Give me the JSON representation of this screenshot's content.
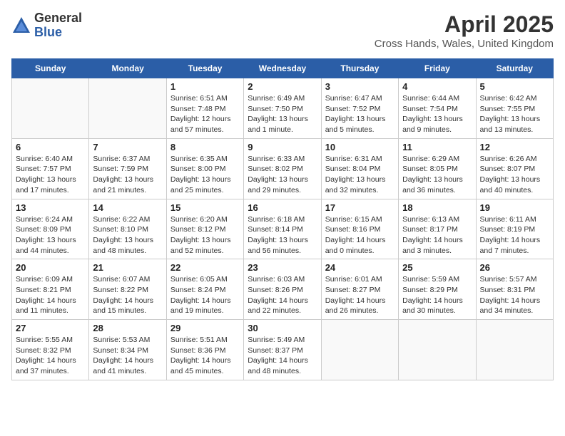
{
  "header": {
    "logo_line1": "General",
    "logo_line2": "Blue",
    "main_title": "April 2025",
    "subtitle": "Cross Hands, Wales, United Kingdom"
  },
  "days_of_week": [
    "Sunday",
    "Monday",
    "Tuesday",
    "Wednesday",
    "Thursday",
    "Friday",
    "Saturday"
  ],
  "weeks": [
    [
      {
        "day": "",
        "info": ""
      },
      {
        "day": "",
        "info": ""
      },
      {
        "day": "1",
        "info": "Sunrise: 6:51 AM\nSunset: 7:48 PM\nDaylight: 12 hours and 57 minutes."
      },
      {
        "day": "2",
        "info": "Sunrise: 6:49 AM\nSunset: 7:50 PM\nDaylight: 13 hours and 1 minute."
      },
      {
        "day": "3",
        "info": "Sunrise: 6:47 AM\nSunset: 7:52 PM\nDaylight: 13 hours and 5 minutes."
      },
      {
        "day": "4",
        "info": "Sunrise: 6:44 AM\nSunset: 7:54 PM\nDaylight: 13 hours and 9 minutes."
      },
      {
        "day": "5",
        "info": "Sunrise: 6:42 AM\nSunset: 7:55 PM\nDaylight: 13 hours and 13 minutes."
      }
    ],
    [
      {
        "day": "6",
        "info": "Sunrise: 6:40 AM\nSunset: 7:57 PM\nDaylight: 13 hours and 17 minutes."
      },
      {
        "day": "7",
        "info": "Sunrise: 6:37 AM\nSunset: 7:59 PM\nDaylight: 13 hours and 21 minutes."
      },
      {
        "day": "8",
        "info": "Sunrise: 6:35 AM\nSunset: 8:00 PM\nDaylight: 13 hours and 25 minutes."
      },
      {
        "day": "9",
        "info": "Sunrise: 6:33 AM\nSunset: 8:02 PM\nDaylight: 13 hours and 29 minutes."
      },
      {
        "day": "10",
        "info": "Sunrise: 6:31 AM\nSunset: 8:04 PM\nDaylight: 13 hours and 32 minutes."
      },
      {
        "day": "11",
        "info": "Sunrise: 6:29 AM\nSunset: 8:05 PM\nDaylight: 13 hours and 36 minutes."
      },
      {
        "day": "12",
        "info": "Sunrise: 6:26 AM\nSunset: 8:07 PM\nDaylight: 13 hours and 40 minutes."
      }
    ],
    [
      {
        "day": "13",
        "info": "Sunrise: 6:24 AM\nSunset: 8:09 PM\nDaylight: 13 hours and 44 minutes."
      },
      {
        "day": "14",
        "info": "Sunrise: 6:22 AM\nSunset: 8:10 PM\nDaylight: 13 hours and 48 minutes."
      },
      {
        "day": "15",
        "info": "Sunrise: 6:20 AM\nSunset: 8:12 PM\nDaylight: 13 hours and 52 minutes."
      },
      {
        "day": "16",
        "info": "Sunrise: 6:18 AM\nSunset: 8:14 PM\nDaylight: 13 hours and 56 minutes."
      },
      {
        "day": "17",
        "info": "Sunrise: 6:15 AM\nSunset: 8:16 PM\nDaylight: 14 hours and 0 minutes."
      },
      {
        "day": "18",
        "info": "Sunrise: 6:13 AM\nSunset: 8:17 PM\nDaylight: 14 hours and 3 minutes."
      },
      {
        "day": "19",
        "info": "Sunrise: 6:11 AM\nSunset: 8:19 PM\nDaylight: 14 hours and 7 minutes."
      }
    ],
    [
      {
        "day": "20",
        "info": "Sunrise: 6:09 AM\nSunset: 8:21 PM\nDaylight: 14 hours and 11 minutes."
      },
      {
        "day": "21",
        "info": "Sunrise: 6:07 AM\nSunset: 8:22 PM\nDaylight: 14 hours and 15 minutes."
      },
      {
        "day": "22",
        "info": "Sunrise: 6:05 AM\nSunset: 8:24 PM\nDaylight: 14 hours and 19 minutes."
      },
      {
        "day": "23",
        "info": "Sunrise: 6:03 AM\nSunset: 8:26 PM\nDaylight: 14 hours and 22 minutes."
      },
      {
        "day": "24",
        "info": "Sunrise: 6:01 AM\nSunset: 8:27 PM\nDaylight: 14 hours and 26 minutes."
      },
      {
        "day": "25",
        "info": "Sunrise: 5:59 AM\nSunset: 8:29 PM\nDaylight: 14 hours and 30 minutes."
      },
      {
        "day": "26",
        "info": "Sunrise: 5:57 AM\nSunset: 8:31 PM\nDaylight: 14 hours and 34 minutes."
      }
    ],
    [
      {
        "day": "27",
        "info": "Sunrise: 5:55 AM\nSunset: 8:32 PM\nDaylight: 14 hours and 37 minutes."
      },
      {
        "day": "28",
        "info": "Sunrise: 5:53 AM\nSunset: 8:34 PM\nDaylight: 14 hours and 41 minutes."
      },
      {
        "day": "29",
        "info": "Sunrise: 5:51 AM\nSunset: 8:36 PM\nDaylight: 14 hours and 45 minutes."
      },
      {
        "day": "30",
        "info": "Sunrise: 5:49 AM\nSunset: 8:37 PM\nDaylight: 14 hours and 48 minutes."
      },
      {
        "day": "",
        "info": ""
      },
      {
        "day": "",
        "info": ""
      },
      {
        "day": "",
        "info": ""
      }
    ]
  ]
}
